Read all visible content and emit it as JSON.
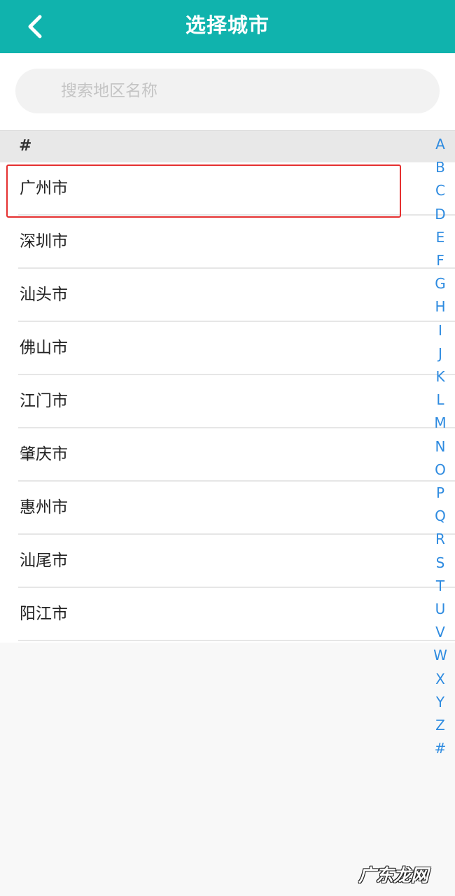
{
  "header": {
    "title": "选择城市",
    "back_icon": "chevron-left-icon",
    "background_color": "#10b3ad"
  },
  "search": {
    "placeholder": "搜索地区名称",
    "value": ""
  },
  "section": {
    "label": "#"
  },
  "cities": [
    {
      "name": "广州市",
      "highlighted": true
    },
    {
      "name": "深圳市"
    },
    {
      "name": "汕头市"
    },
    {
      "name": "佛山市"
    },
    {
      "name": "江门市"
    },
    {
      "name": "肇庆市"
    },
    {
      "name": "惠州市"
    },
    {
      "name": "汕尾市"
    },
    {
      "name": "阳江市"
    }
  ],
  "index_letters": [
    "A",
    "B",
    "C",
    "D",
    "E",
    "F",
    "G",
    "H",
    "I",
    "J",
    "K",
    "L",
    "M",
    "N",
    "O",
    "P",
    "Q",
    "R",
    "S",
    "T",
    "U",
    "V",
    "W",
    "X",
    "Y",
    "Z",
    "#"
  ],
  "highlight_color": "#e53030",
  "index_color": "#2e8be0",
  "watermark": "广东龙网"
}
